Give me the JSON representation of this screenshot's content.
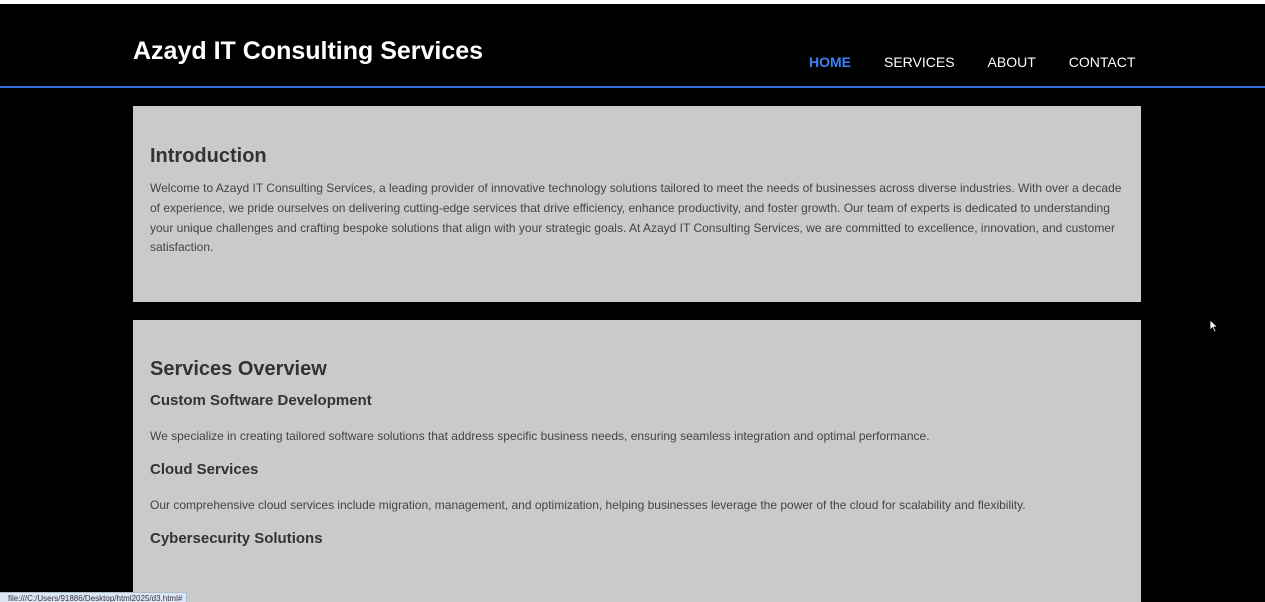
{
  "header": {
    "brand": "Azayd IT Consulting Services",
    "nav": [
      {
        "label": "HOME",
        "active": true
      },
      {
        "label": "SERVICES",
        "active": false
      },
      {
        "label": "ABOUT",
        "active": false
      },
      {
        "label": "CONTACT",
        "active": false
      }
    ]
  },
  "introduction": {
    "title": "Introduction",
    "text": "Welcome to Azayd IT Consulting Services, a leading provider of innovative technology solutions tailored to meet the needs of businesses across diverse industries. With over a decade of experience, we pride ourselves on delivering cutting-edge services that drive efficiency, enhance productivity, and foster growth. Our team of experts is dedicated to understanding your unique challenges and crafting bespoke solutions that align with your strategic goals. At Azayd IT Consulting Services, we are committed to excellence, innovation, and customer satisfaction."
  },
  "services_overview": {
    "title": "Services Overview",
    "items": [
      {
        "title": "Custom Software Development",
        "desc": "We specialize in creating tailored software solutions that address specific business needs, ensuring seamless integration and optimal performance."
      },
      {
        "title": "Cloud Services",
        "desc": "Our comprehensive cloud services include migration, management, and optimization, helping businesses leverage the power of the cloud for scalability and flexibility."
      },
      {
        "title": "Cybersecurity Solutions",
        "desc": ""
      }
    ]
  },
  "status_bar": {
    "url": "file:///C:/Users/91886/Desktop/html2025/d3.html#"
  },
  "colors": {
    "background": "#000000",
    "card": "#cacacc",
    "accent": "#3b82f6",
    "header_border": "#2f6fd0"
  },
  "icons": {
    "cursor": "mouse-pointer-icon"
  }
}
